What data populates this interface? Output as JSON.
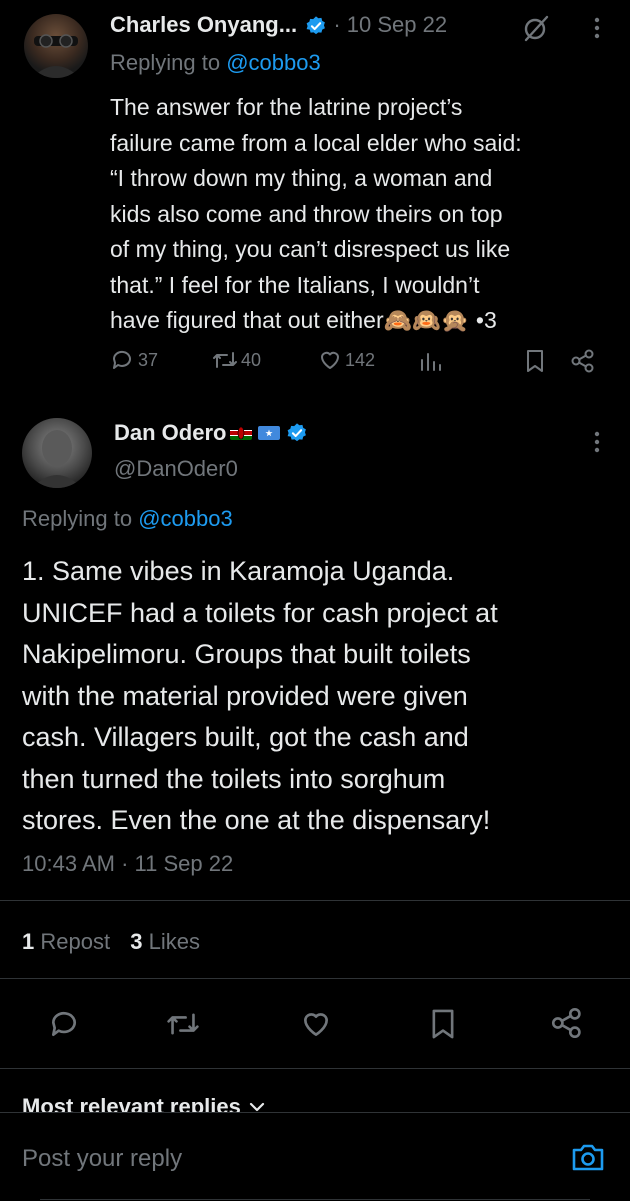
{
  "first_tweet": {
    "author_name": "Charles Onyang...",
    "date": "· 10 Sep 22",
    "replying_prefix": "Replying to",
    "replying_handle": "@cobbo3",
    "text": "The answer for the latrine project’s failure came from a local elder who said: “I throw down my thing, a woman and kids also come and throw theirs on top of my thing, you can’t disrespect us like that.” I feel for the Italians, I wouldn’t have figured that out either🙈🙉🙊 •3",
    "lines": [
      "The answer for the latrine project’s",
      "failure came from a local elder who said:",
      "“I throw down my thing, a woman and",
      "kids also come and throw theirs on top",
      "of my thing, you can’t disrespect us like",
      "that.” I feel for the Italians, I wouldn’t",
      "have figured that out either🙈🙉🙊 •3"
    ],
    "replies": "37",
    "reposts": "40",
    "likes": "142"
  },
  "main_tweet": {
    "author_name": "Dan Odero",
    "handle": "@DanOder0",
    "replying_prefix": "Replying to",
    "replying_handle": "@cobbo3",
    "text": "1. Same vibes in Karamoja Uganda. UNICEF had a toilets for cash project at Nakipelimoru. Groups that built toilets with the material provided were given cash. Villagers built, got the cash and then turned the toilets into sorghum stores.  Even the one at the dispensary!",
    "lines": [
      "1. Same vibes in Karamoja Uganda.",
      "UNICEF had a toilets for cash project at",
      "Nakipelimoru. Groups that built toilets",
      "with the material provided were given",
      "cash. Villagers built, got the cash and",
      "then turned the toilets into sorghum",
      "stores.  Even the one at the dispensary!"
    ],
    "timestamp": "10:43 AM · 11 Sep 22",
    "repost_count": "1",
    "repost_label": "Repost",
    "like_count": "3",
    "like_label": "Likes"
  },
  "replies_filter": "Most relevant replies",
  "reply_box": {
    "placeholder": "Post your reply"
  },
  "colors": {
    "accent": "#1d9bf0",
    "muted": "#71767b",
    "text": "#e7e9ea",
    "background": "#000000"
  }
}
